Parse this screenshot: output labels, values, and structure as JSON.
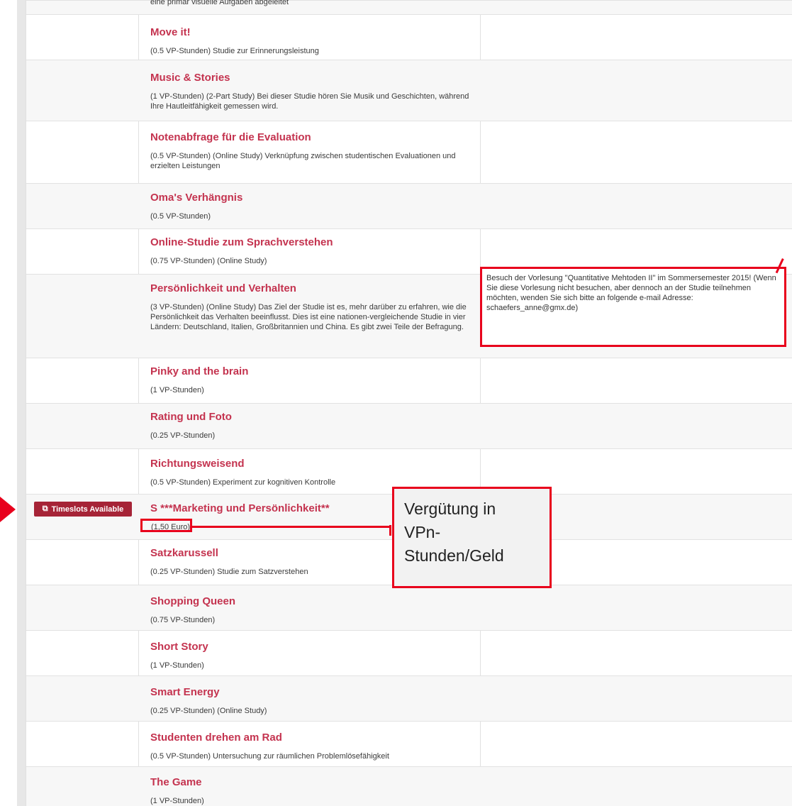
{
  "cut_off_top_text": "eine primär visuelle Aufgaben abgeleitet",
  "studies": [
    {
      "title": "Move it!",
      "desc": "(0.5 VP-Stunden) Studie zur Erinnerungsleistung"
    },
    {
      "title": "Music & Stories",
      "desc": "(1 VP-Stunden) (2-Part Study) Bei dieser Studie hören Sie Musik und Geschichten, während Ihre Hautleitfähigkeit gemessen wird."
    },
    {
      "title": "Notenabfrage für die Evaluation",
      "desc": "(0.5 VP-Stunden) (Online Study) Verknüpfung zwischen studentischen Evaluationen und erzielten Leistungen"
    },
    {
      "title": "Oma's Verhängnis",
      "desc": "(0.5 VP-Stunden)"
    },
    {
      "title": "Online-Studie zum Sprachverstehen",
      "desc": "(0.75 VP-Stunden) (Online Study)"
    },
    {
      "title": "Persönlichkeit und Verhalten",
      "desc": "(3 VP-Stunden) (Online Study) Das Ziel der Studie ist es, mehr darüber zu erfahren, wie die Persönlichkeit das Verhalten beeinflusst. Dies ist eine nationen-vergleichende Studie in vier Ländern: Deutschland, Italien, Großbritannien und China. Es gibt zwei Teile der Befragung."
    },
    {
      "title": "Pinky and the brain",
      "desc": "(1 VP-Stunden)"
    },
    {
      "title": "Rating und Foto",
      "desc": "(0.25 VP-Stunden)"
    },
    {
      "title": "Richtungsweisend",
      "desc": "(0.5 VP-Stunden) Experiment zur kognitiven Kontrolle"
    },
    {
      "title": "S ***Marketing und Persönlichkeit**",
      "desc": "(1,50 Euro)"
    },
    {
      "title": "Satzkarussell",
      "desc": "(0.25 VP-Stunden) Studie zum Satzverstehen"
    },
    {
      "title": "Shopping Queen",
      "desc": "(0.75 VP-Stunden)"
    },
    {
      "title": "Short Story",
      "desc": "(1 VP-Stunden)"
    },
    {
      "title": "Smart Energy",
      "desc": "(0.25 VP-Stunden) (Online Study)"
    },
    {
      "title": "Studenten drehen am Rad",
      "desc": "(0.5 VP-Stunden) Untersuchung zur räumlichen Problemlösefähigkeit"
    },
    {
      "title": "The Game",
      "desc": "(1 VP-Stunden)"
    }
  ],
  "badge": {
    "label": "Timeslots Available",
    "icon": "external-link-icon"
  },
  "eligibility_note": "Besuch der Vorlesung \"Quantitative Mehtoden II\" im Sommersemester 2015! (Wenn Sie diese Vorlesung nicht besuchen, aber dennoch an der Studie teilnehmen möchten, wenden Sie sich bitte an folgende e-mail Adresse: schaefers_anne@gmx.de)",
  "callout": {
    "line1": "Vergütung in",
    "line2": "VPn-",
    "line3": "Stunden/Geld"
  },
  "colors": {
    "title": "#c4334f",
    "badge": "#a62437",
    "annotation": "#e8001c"
  }
}
